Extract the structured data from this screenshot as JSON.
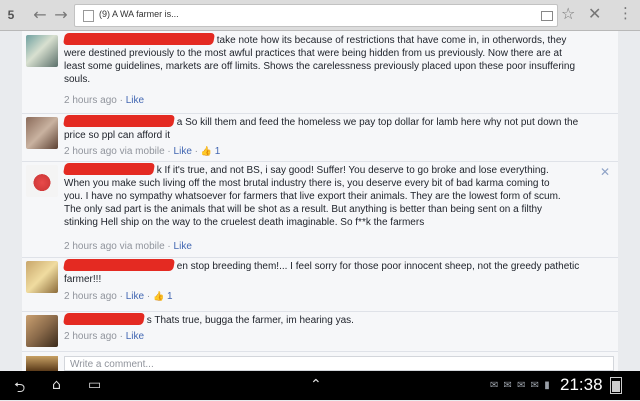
{
  "browser": {
    "tab_count": "5",
    "url_text": "(9) A WA farmer is...",
    "back_icon": "arrow-left-icon",
    "forward_icon": "arrow-right-icon",
    "star_icon": "star-icon",
    "close_icon": "close-icon",
    "menu_icon": "menu-icon"
  },
  "comments": [
    {
      "name": "",
      "text": "take note how its because of restrictions that have come in, in otherwords, they were destined previously to the most awful practices that were being hidden from us previously. Now there are at least some guidelines, markets are off limits. Shows the carelessness previously placed upon these poor insuffering souls.",
      "time": "2 hours ago",
      "via": "",
      "like_label": "Like",
      "likes": ""
    },
    {
      "name": "",
      "text": "a So kill them and feed the homeless we pay top dollar for lamb here why not put down the price so ppl can afford it",
      "time": "2 hours ago",
      "via": "via mobile",
      "like_label": "Like",
      "likes": "1"
    },
    {
      "name": "",
      "text": "k If it's true, and not BS, i say good! Suffer! You deserve to go broke and lose everything. When you make such living off the most brutal industry there is, you deserve every bit of bad karma coming to you. I have no sympathy whatsoever for farmers that live export their animals. They are the lowest form of scum. The only sad part is the animals that will be shot as a result. But anything is better than being sent on a filthy stinking Hell ship on the way to the cruelest death imaginable. So f**k the farmers",
      "time": "2 hours ago",
      "via": "via mobile",
      "like_label": "Like",
      "likes": ""
    },
    {
      "name": "",
      "text": "en stop breeding them!... I feel sorry for those poor innocent sheep, not the greedy pathetic farmer!!!",
      "time": "2 hours ago",
      "via": "",
      "like_label": "Like",
      "likes": "1"
    },
    {
      "name": "",
      "text": "s Thats true, bugga the farmer, im hearing yas.",
      "time": "2 hours ago",
      "via": "",
      "like_label": "Like",
      "likes": ""
    }
  ],
  "composer": {
    "placeholder": "Write a comment..."
  },
  "system_bar": {
    "clock": "21:38",
    "icons": "✉ ✉ ✉ ✉ ▮",
    "back_icon": "back-icon",
    "home_icon": "home-icon",
    "recents_icon": "recents-icon",
    "menu_icon": "menu-icon"
  },
  "colors": {
    "link": "#4267b2",
    "redaction": "#e42a22",
    "meta": "#90949c",
    "feed_bg": "#f6f7f9"
  }
}
